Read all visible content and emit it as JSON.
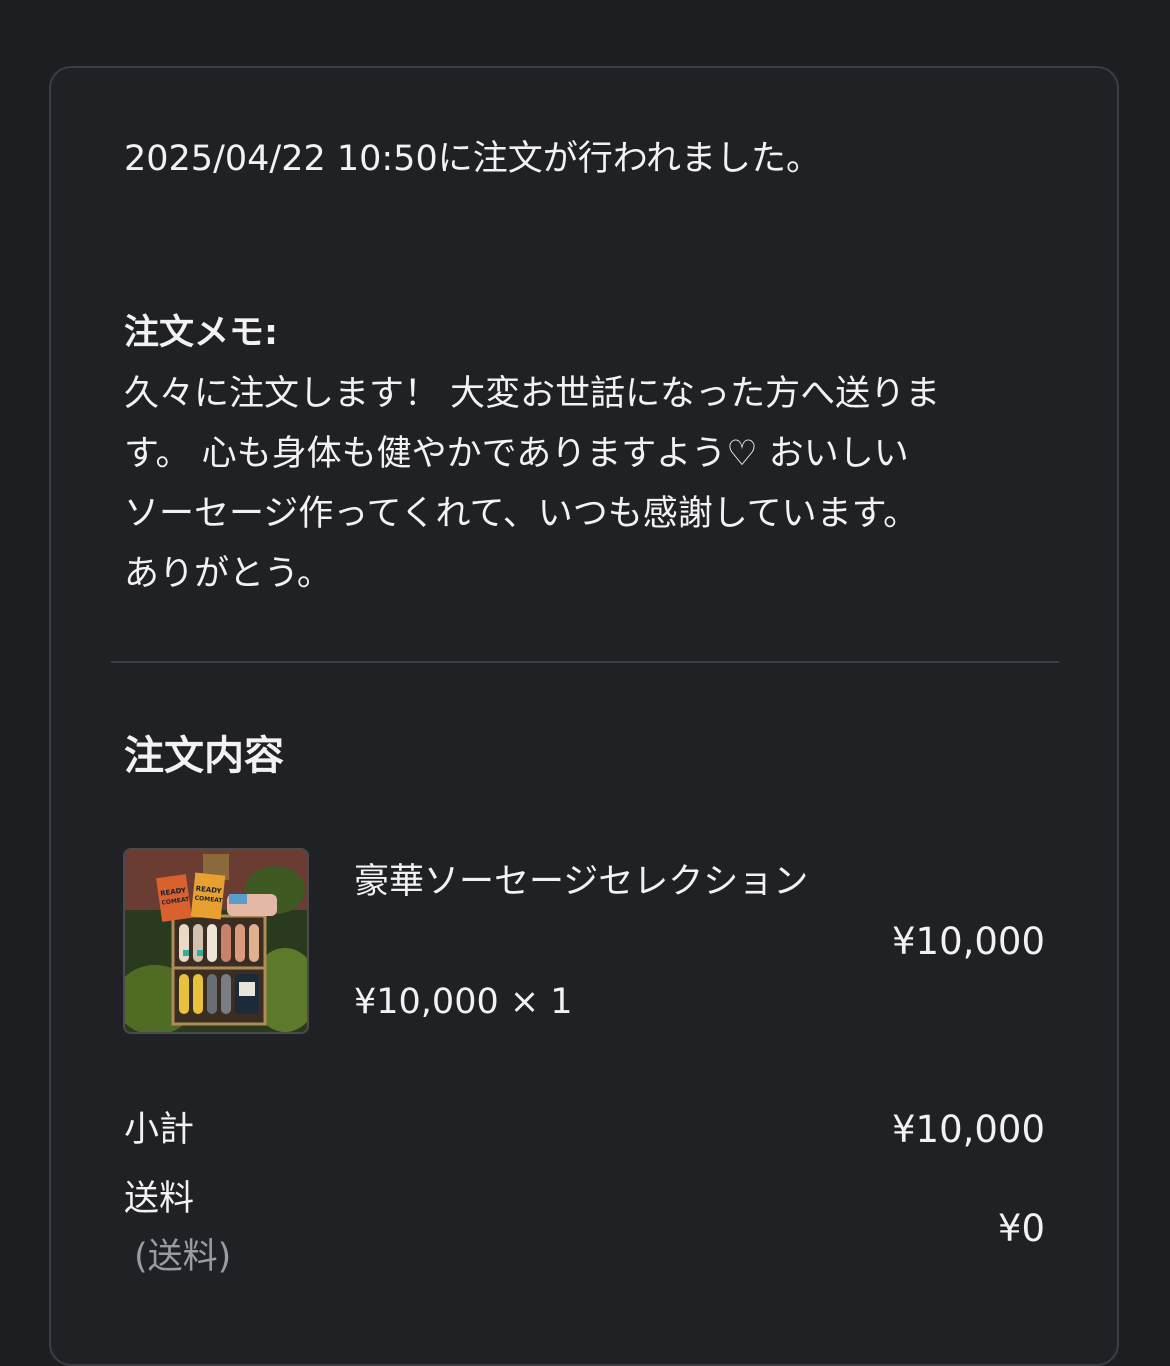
{
  "order": {
    "placed_text": "2025/04/22 10:50に注文が行われました。"
  },
  "memo": {
    "heading": "注文メモ:",
    "body": "久々に注文します！ 大変お世話になった方へ送りま\nす。 心も身体も健やかでありますよう♡ おいしい\nソーセージ作ってくれて、いつも感謝しています。\nありがとう。"
  },
  "contents": {
    "title": "注文内容",
    "items": [
      {
        "name": "豪華ソーセージセレクション",
        "unit_line": "¥10,000 × 1",
        "total": "¥10,000",
        "thumbnail": {
          "icon": "product-photo-icon",
          "package_text": [
            "READY",
            "COMEAT",
            "READY",
            "COMEAT"
          ]
        }
      }
    ]
  },
  "summary": {
    "subtotal_label": "小計",
    "subtotal_value": "¥10,000",
    "shipping_label": "送料",
    "shipping_sublabel": "(送料)",
    "shipping_value": "¥0"
  },
  "colors": {
    "background": "#1d1e22",
    "card": "#202125",
    "border": "#3c3d42",
    "text": "#f2f2f4",
    "muted": "#9a9ba0"
  }
}
